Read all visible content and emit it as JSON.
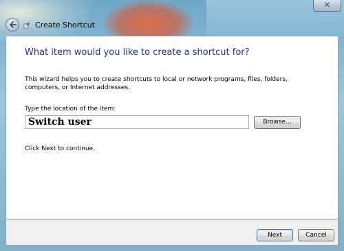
{
  "window": {
    "title": "Create Shortcut",
    "close_symbol": "✕"
  },
  "content": {
    "heading": "What item would you like to create a shortcut for?",
    "description": "This wizard helps you to create shortcuts to local or network programs, files, folders, computers, or Internet addresses.",
    "location_label": "Type the location of the item:",
    "location_value": "Switch user",
    "browse_label": "Browse...",
    "next_hint": "Click Next to continue."
  },
  "footer": {
    "next_label": "Next",
    "cancel_label": "Cancel"
  },
  "icons": {
    "back": "back-arrow-icon",
    "wizard": "shortcut-wizard-icon",
    "close": "close-icon"
  }
}
